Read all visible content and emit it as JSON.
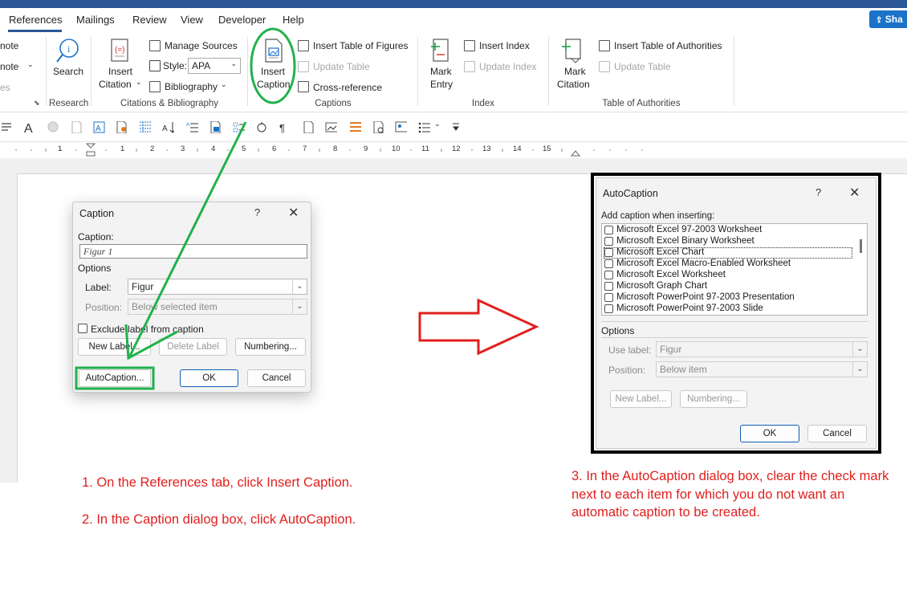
{
  "tabs": [
    "References",
    "Mailings",
    "Review",
    "View",
    "Developer",
    "Help"
  ],
  "share_label": "Sha",
  "ribbon": {
    "left_cut": {
      "item1": "note",
      "item2": "note",
      "item3": "es"
    },
    "research": {
      "search": "Search",
      "group": "Research"
    },
    "citations": {
      "insert_citation_1": "Insert",
      "insert_citation_2": "Citation",
      "manage_sources": "Manage Sources",
      "style_label": "Style:",
      "style_value": "APA",
      "bibliography": "Bibliography",
      "group": "Citations & Bibliography"
    },
    "captions": {
      "insert_caption_1": "Insert",
      "insert_caption_2": "Caption",
      "insert_table_of_figures": "Insert Table of Figures",
      "update_table": "Update Table",
      "cross_reference": "Cross-reference",
      "group": "Captions"
    },
    "index": {
      "mark_entry_1": "Mark",
      "mark_entry_2": "Entry",
      "insert_index": "Insert Index",
      "update_index": "Update Index",
      "group": "Index"
    },
    "toa": {
      "mark_citation_1": "Mark",
      "mark_citation_2": "Citation",
      "insert_toa": "Insert Table of Authorities",
      "update_table": "Update Table",
      "group": "Table of Authorities"
    }
  },
  "ruler_numbers": [
    "1",
    "1",
    "2",
    "3",
    "4",
    "5",
    "6",
    "7",
    "8",
    "9",
    "10",
    "11",
    "12",
    "13",
    "14",
    "15"
  ],
  "caption_dialog": {
    "title": "Caption",
    "help": "?",
    "close": "✕",
    "caption_label": "Caption:",
    "caption_value": "Figur 1",
    "options_heading": "Options",
    "label_label": "Label:",
    "label_value": "Figur",
    "position_label": "Position:",
    "position_value": "Below selected item",
    "exclude_label": "Exclude label from caption",
    "new_label": "New Label...",
    "delete_label": "Delete Label",
    "numbering": "Numbering...",
    "autocaption": "AutoCaption...",
    "ok": "OK",
    "cancel": "Cancel"
  },
  "autocaption_dialog": {
    "title": "AutoCaption",
    "help": "?",
    "close": "✕",
    "add_caption_label": "Add caption when inserting:",
    "items": [
      "Microsoft Excel 97-2003 Worksheet",
      "Microsoft Excel Binary Worksheet",
      "Microsoft Excel Chart",
      "Microsoft Excel Macro-Enabled Worksheet",
      "Microsoft Excel Worksheet",
      "Microsoft Graph Chart",
      "Microsoft PowerPoint 97-2003 Presentation",
      "Microsoft PowerPoint 97-2003 Slide"
    ],
    "options_heading": "Options",
    "use_label_label": "Use label:",
    "use_label_value": "Figur",
    "position_label": "Position:",
    "position_value": "Below item",
    "new_label": "New Label...",
    "numbering": "Numbering...",
    "ok": "OK",
    "cancel": "Cancel"
  },
  "instructions": {
    "step1": "1. On the References tab, click Insert Caption.",
    "step2": "2. In the Caption dialog box, click AutoCaption.",
    "step3": "3. In the AutoCaption dialog box, clear the check mark next to each item for which you do not want an automatic caption to be created."
  },
  "colors": {
    "accent": "#2b5797",
    "annotation_green": "#22b14c",
    "annotation_red": "#e0201e",
    "share": "#1a73c8"
  }
}
